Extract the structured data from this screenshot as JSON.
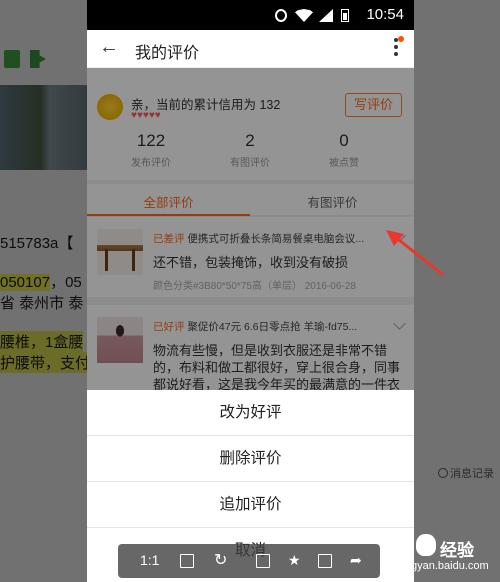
{
  "statusbar": {
    "time": "10:54"
  },
  "background": {
    "order_line1": "515783a【",
    "order_line2_hl": "050107",
    "order_line2_rest": "，05",
    "order_line3": "省 泰州市 泰",
    "order_line4": "腰椎，1盒腰",
    "order_line5": "护腰带，支付",
    "message_label": "消息记录"
  },
  "header": {
    "title": "我的评价"
  },
  "credit": {
    "text": "亲，当前的累计信用为 132",
    "hearts": "♥♥♥♥♥",
    "write_button": "写评价"
  },
  "stats": [
    {
      "num": "122",
      "label": "发布评价"
    },
    {
      "num": "2",
      "label": "有图评价"
    },
    {
      "num": "0",
      "label": "被点赞"
    }
  ],
  "tabs": [
    {
      "label": "全部评价"
    },
    {
      "label": "有图评价"
    }
  ],
  "reviews": [
    {
      "tag": "已差评",
      "title": "便携式可折叠长条简易餐桌电脑会议...",
      "text": "还不错，包装掩饰，收到没有破损",
      "meta": "颜色分类#3B80*50*75高（单层） 2016-06-28"
    },
    {
      "tag": "已好评",
      "title": "聚促价47元 6.6日零点抢 羊瑜-fd75...",
      "text": "物流有些慢，但是收到衣服还是非常不错的，布料和做工都很好，穿上很合身，同事都说好看，这是我今年买的最满意的一件衣服"
    }
  ],
  "sheet": {
    "items": [
      "改为好评",
      "删除评价",
      "追加评价",
      "取消"
    ]
  },
  "viewer_toolbar": {
    "ratio_label": "1:1"
  },
  "watermark": {
    "brand": "Bai",
    "sub": "经验",
    "url": "jingyan.baidu.com"
  },
  "colors": {
    "accent": "#ff6a1a",
    "annotation_arrow": "#e8382e"
  }
}
